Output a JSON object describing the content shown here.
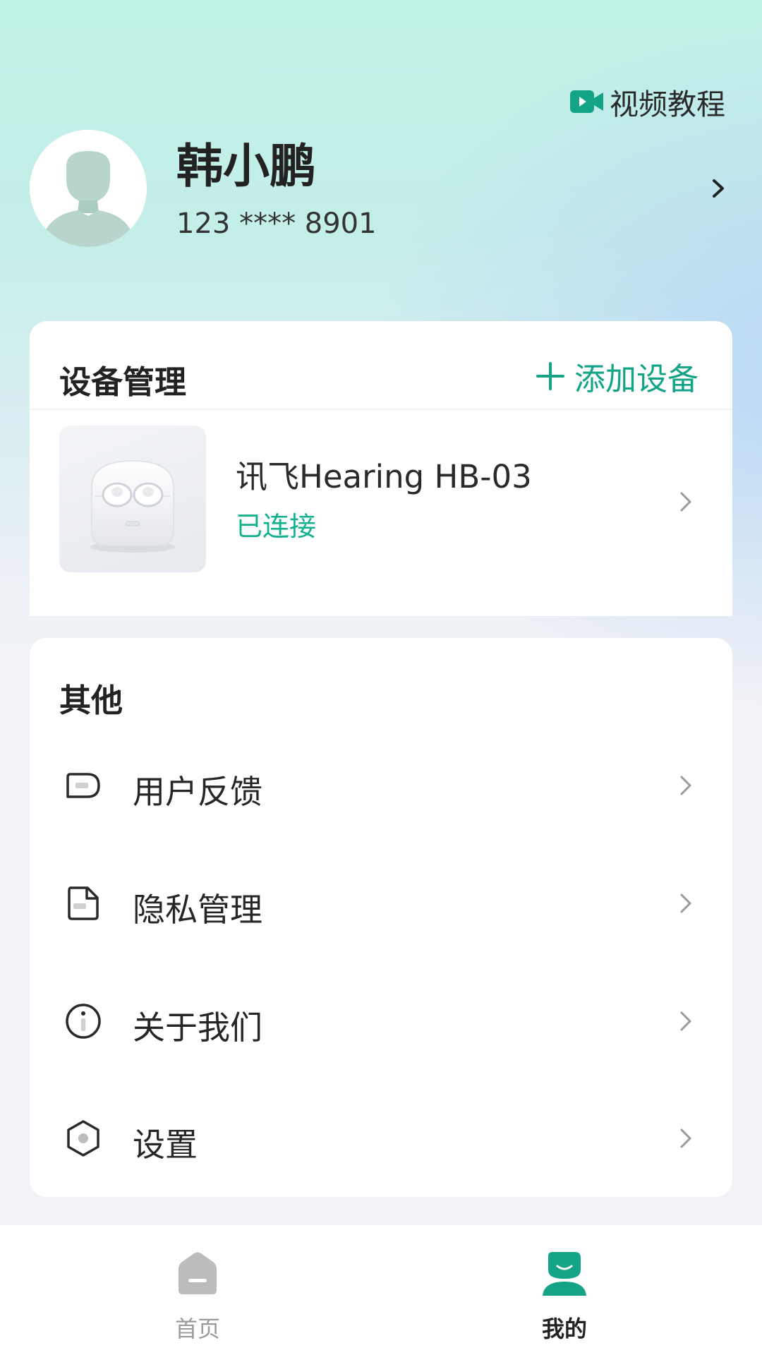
{
  "header": {
    "video_tutorial_label": "视频教程",
    "video_icon": "video-camera-icon"
  },
  "profile": {
    "name": "韩小鹏",
    "phone": "123 **** 8901",
    "avatar_icon": "default-avatar"
  },
  "device_section": {
    "title": "设备管理",
    "add_label": "添加设备",
    "devices": [
      {
        "name": "讯飞Hearing HB-03",
        "status": "已连接",
        "status_color": "#13b28e"
      }
    ]
  },
  "other_section": {
    "title": "其他",
    "items": [
      {
        "label": "用户反馈",
        "icon": "feedback-icon"
      },
      {
        "label": "隐私管理",
        "icon": "privacy-document-icon"
      },
      {
        "label": "关于我们",
        "icon": "info-icon"
      },
      {
        "label": "设置",
        "icon": "settings-hexagon-icon"
      }
    ]
  },
  "tabbar": {
    "tabs": [
      {
        "label": "首页",
        "icon": "home-icon",
        "active": false
      },
      {
        "label": "我的",
        "icon": "profile-icon",
        "active": true
      }
    ]
  },
  "colors": {
    "accent": "#13a487",
    "inactive_tab": "#bcbcbc",
    "page_background": "#f1f2f6"
  }
}
